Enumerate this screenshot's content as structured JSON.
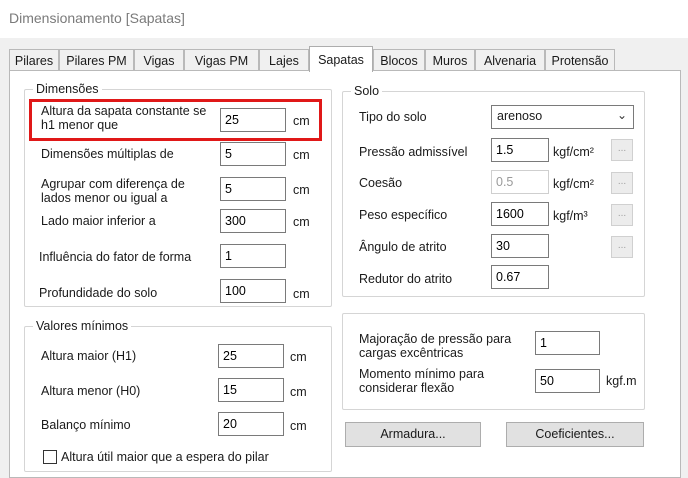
{
  "window": {
    "title": "Dimensionamento [Sapatas]"
  },
  "tabs": [
    {
      "label": "Pilares"
    },
    {
      "label": "Pilares PM"
    },
    {
      "label": "Vigas"
    },
    {
      "label": "Vigas PM"
    },
    {
      "label": "Lajes"
    },
    {
      "label": "Sapatas"
    },
    {
      "label": "Blocos"
    },
    {
      "label": "Muros"
    },
    {
      "label": "Alvenaria"
    },
    {
      "label": "Protensão"
    }
  ],
  "dimensoes": {
    "title": "Dimensões",
    "altura_constante": {
      "label": "Altura da sapata constante se\nh1 menor que",
      "value": "25",
      "unit": "cm"
    },
    "multiplas": {
      "label": "Dimensões múltiplas de",
      "value": "5",
      "unit": "cm"
    },
    "agrupar": {
      "label": "Agrupar com diferença de\nlados menor ou igual a",
      "value": "5",
      "unit": "cm"
    },
    "lado_maior": {
      "label": "Lado maior inferior a",
      "value": "300",
      "unit": "cm"
    },
    "influencia": {
      "label": "Influência do fator de forma",
      "value": "1"
    },
    "profundidade": {
      "label": "Profundidade do solo",
      "value": "100",
      "unit": "cm"
    }
  },
  "valores_minimos": {
    "title": "Valores mínimos",
    "altura_maior": {
      "label": "Altura maior (H1)",
      "value": "25",
      "unit": "cm"
    },
    "altura_menor": {
      "label": "Altura menor (H0)",
      "value": "15",
      "unit": "cm"
    },
    "balanco": {
      "label": "Balanço mínimo",
      "value": "20",
      "unit": "cm"
    },
    "checkbox": {
      "label": "Altura útil maior que a espera do pilar",
      "checked": false
    }
  },
  "solo": {
    "title": "Solo",
    "tipo": {
      "label": "Tipo do solo",
      "value": "arenoso"
    },
    "pressao": {
      "label": "Pressão admissível",
      "value": "1.5",
      "unit": "kgf/cm²"
    },
    "coesao": {
      "label": "Coesão",
      "value": "0.5",
      "unit": "kgf/cm²"
    },
    "peso": {
      "label": "Peso específico",
      "value": "1600",
      "unit": "kgf/m³"
    },
    "angulo": {
      "label": "Ângulo de atrito",
      "value": "30"
    },
    "redutor": {
      "label": "Redutor do atrito",
      "value": "0.67"
    },
    "dots_label": "..."
  },
  "extra": {
    "majoracao": {
      "label": "Majoração de pressão para\ncargas excêntricas",
      "value": "1"
    },
    "momento": {
      "label": "Momento mínimo para\nconsiderar flexão",
      "value": "50",
      "unit": "kgf.m"
    }
  },
  "buttons": {
    "armadura": "Armadura...",
    "coeficientes": "Coeficientes..."
  },
  "colors": {
    "highlight": "#e01818",
    "panel": "#ffffff",
    "dialog": "#f0f0f0"
  }
}
